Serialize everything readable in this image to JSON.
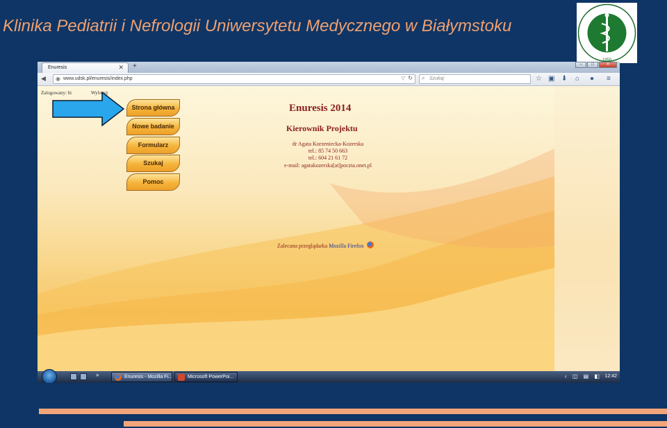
{
  "slide": {
    "title": "Klinika Pediatrii i Nefrologii Uniwersytetu Medycznego w Białymstoku",
    "logo_text": "UNIWERSYTET MEDYCZNY W BIAŁYMSTOKU",
    "logo_year": "1950",
    "accent_color": "#f3a57a",
    "background_color": "#0e3566"
  },
  "browser": {
    "tab_title": "Enuresis",
    "url": "www.udsk.pl/enuresis/index.php",
    "search_placeholder": "Szukaj"
  },
  "page": {
    "logged_in": "Zalogowany: bi",
    "logout": "Wyloguj",
    "menu": [
      {
        "label": "Strona główna"
      },
      {
        "label": "Nowe badanie"
      },
      {
        "label": "Formularz"
      },
      {
        "label": "Szukaj"
      },
      {
        "label": "Pomoc"
      }
    ],
    "heading": "Enuresis 2014",
    "subheading": "Kierownik Projektu",
    "contact": {
      "name": "dr Agata Korzeniecka-Kozerska",
      "tel1": "tel.: 85 74 50 663",
      "tel2": "tel.: 604 21 61 72",
      "email": "e-mail: agatakozerska[at]poczta.onet.pl"
    },
    "recommend_text": "Zalecana przeglądarka ",
    "recommend_link": "Mozilla Firefox"
  },
  "taskbar": {
    "items": [
      {
        "label": "Enuresis - Mozilla Fi..."
      },
      {
        "label": "Microsoft PowerPoi..."
      }
    ],
    "clock": "12:42"
  }
}
